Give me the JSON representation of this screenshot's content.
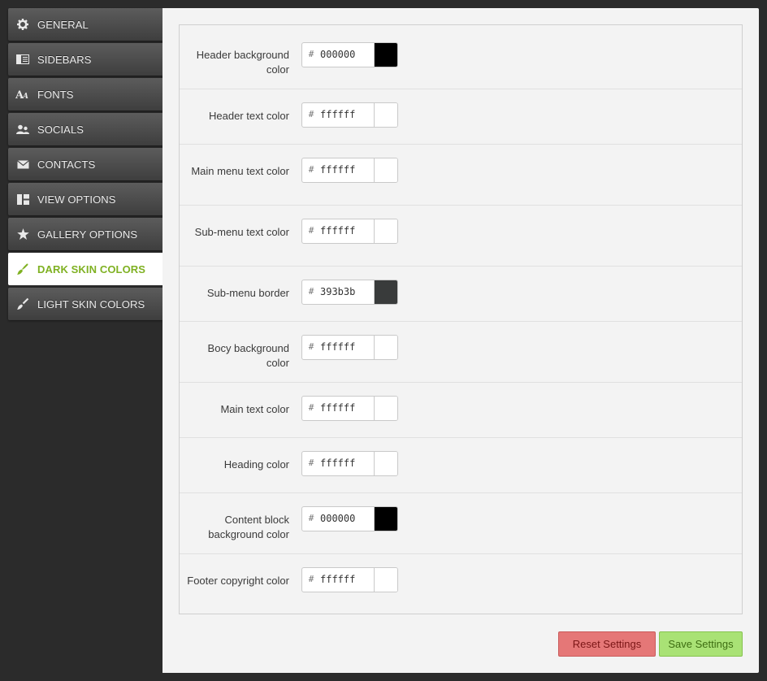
{
  "sidebar": {
    "items": [
      {
        "label": "GENERAL",
        "icon": "gear-icon"
      },
      {
        "label": "SIDEBARS",
        "icon": "sidebar-layout-icon"
      },
      {
        "label": "FONTS",
        "icon": "font-icon"
      },
      {
        "label": "SOCIALS",
        "icon": "users-icon"
      },
      {
        "label": "CONTACTS",
        "icon": "envelope-icon"
      },
      {
        "label": "VIEW OPTIONS",
        "icon": "layout-icon"
      },
      {
        "label": "GALLERY OPTIONS",
        "icon": "star-icon"
      },
      {
        "label": "DARK SKIN COLORS",
        "icon": "brush-icon",
        "active": true
      },
      {
        "label": "LIGHT SKIN COLORS",
        "icon": "brush-icon"
      }
    ],
    "active_color": "#7fb122"
  },
  "fields": [
    {
      "label": "Header background color",
      "hash": "#",
      "value": "000000",
      "swatch": "#000000"
    },
    {
      "label": "Header text color",
      "hash": "#",
      "value": "ffffff",
      "swatch": "#ffffff"
    },
    {
      "label": "Main menu text color",
      "hash": "#",
      "value": "ffffff",
      "swatch": "#ffffff"
    },
    {
      "label": "Sub-menu text color",
      "hash": "#",
      "value": "ffffff",
      "swatch": "#ffffff"
    },
    {
      "label": "Sub-menu border",
      "hash": "#",
      "value": "393b3b",
      "swatch": "#393b3b"
    },
    {
      "label": "Bocy background color",
      "hash": "#",
      "value": "ffffff",
      "swatch": "#ffffff"
    },
    {
      "label": "Main text color",
      "hash": "#",
      "value": "ffffff",
      "swatch": "#ffffff"
    },
    {
      "label": "Heading color",
      "hash": "#",
      "value": "ffffff",
      "swatch": "#ffffff"
    },
    {
      "label": "Content block background color",
      "hash": "#",
      "value": "000000",
      "swatch": "#000000"
    },
    {
      "label": "Footer copyright color",
      "hash": "#",
      "value": "ffffff",
      "swatch": "#ffffff"
    }
  ],
  "actions": {
    "reset_label": "Reset Settings",
    "save_label": "Save Settings"
  }
}
